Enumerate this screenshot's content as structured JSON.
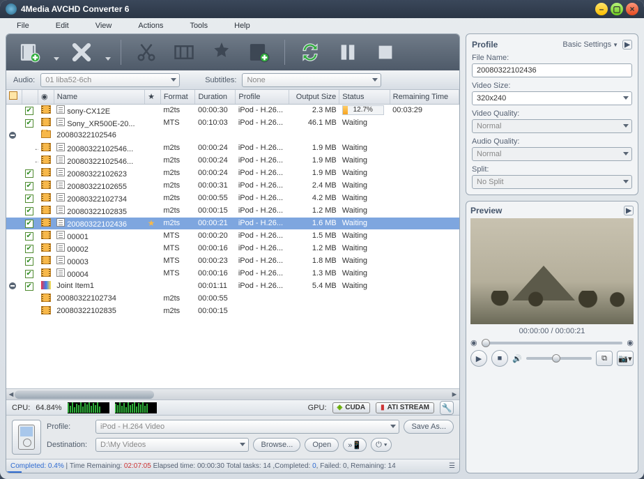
{
  "title": "4Media AVCHD Converter 6",
  "menu": {
    "file": "File",
    "edit": "Edit",
    "view": "View",
    "actions": "Actions",
    "tools": "Tools",
    "help": "Help"
  },
  "strip": {
    "audio_label": "Audio:",
    "audio_value": "01 liba52-6ch",
    "subtitles_label": "Subtitles:",
    "subtitles_value": "None"
  },
  "columns": {
    "name": "Name",
    "format": "Format",
    "duration": "Duration",
    "profile": "Profile",
    "output": "Output Size",
    "status": "Status",
    "remaining": "Remaining Time"
  },
  "rows": [
    {
      "type": "file",
      "indent": 0,
      "chk": true,
      "name": "sony-CX12E",
      "format": "m2ts",
      "duration": "00:00:30",
      "profile": "iPod - H.26...",
      "output": "2.3 MB",
      "status_pct": "12.7%",
      "remaining": "00:03:29"
    },
    {
      "type": "file",
      "indent": 0,
      "chk": true,
      "name": "Sony_XR500E-20...",
      "format": "MTS",
      "duration": "00:10:03",
      "profile": "iPod - H.26...",
      "output": "46.1 MB",
      "status": "Waiting",
      "remaining": ""
    },
    {
      "type": "folder",
      "indent": 0,
      "twisty": true,
      "name": "20080322102546"
    },
    {
      "type": "file",
      "indent": 1,
      "chk": true,
      "name": "20080322102546...",
      "format": "m2ts",
      "duration": "00:00:24",
      "profile": "iPod - H.26...",
      "output": "1.9 MB",
      "status": "Waiting",
      "remaining": ""
    },
    {
      "type": "file",
      "indent": 1,
      "chk": true,
      "name": "20080322102546...",
      "format": "m2ts",
      "duration": "00:00:24",
      "profile": "iPod - H.26...",
      "output": "1.9 MB",
      "status": "Waiting",
      "remaining": ""
    },
    {
      "type": "file",
      "indent": 0,
      "chk": true,
      "name": "20080322102623",
      "format": "m2ts",
      "duration": "00:00:24",
      "profile": "iPod - H.26...",
      "output": "1.9 MB",
      "status": "Waiting",
      "remaining": ""
    },
    {
      "type": "file",
      "indent": 0,
      "chk": true,
      "name": "20080322102655",
      "format": "m2ts",
      "duration": "00:00:31",
      "profile": "iPod - H.26...",
      "output": "2.4 MB",
      "status": "Waiting",
      "remaining": ""
    },
    {
      "type": "file",
      "indent": 0,
      "chk": true,
      "name": "20080322102734",
      "format": "m2ts",
      "duration": "00:00:55",
      "profile": "iPod - H.26...",
      "output": "4.2 MB",
      "status": "Waiting",
      "remaining": ""
    },
    {
      "type": "file",
      "indent": 0,
      "chk": true,
      "name": "20080322102835",
      "format": "m2ts",
      "duration": "00:00:15",
      "profile": "iPod - H.26...",
      "output": "1.2 MB",
      "status": "Waiting",
      "remaining": ""
    },
    {
      "type": "file",
      "indent": 0,
      "chk": true,
      "selected": true,
      "star": true,
      "name": "20080322102436",
      "format": "m2ts",
      "duration": "00:00:21",
      "profile": "iPod - H.26...",
      "output": "1.6 MB",
      "status": "Waiting",
      "remaining": ""
    },
    {
      "type": "file",
      "indent": 0,
      "chk": true,
      "name": "00001",
      "format": "MTS",
      "duration": "00:00:20",
      "profile": "iPod - H.26...",
      "output": "1.5 MB",
      "status": "Waiting",
      "remaining": ""
    },
    {
      "type": "file",
      "indent": 0,
      "chk": true,
      "name": "00002",
      "format": "MTS",
      "duration": "00:00:16",
      "profile": "iPod - H.26...",
      "output": "1.2 MB",
      "status": "Waiting",
      "remaining": ""
    },
    {
      "type": "file",
      "indent": 0,
      "chk": true,
      "name": "00003",
      "format": "MTS",
      "duration": "00:00:23",
      "profile": "iPod - H.26...",
      "output": "1.8 MB",
      "status": "Waiting",
      "remaining": ""
    },
    {
      "type": "file",
      "indent": 0,
      "chk": true,
      "name": "00004",
      "format": "MTS",
      "duration": "00:00:16",
      "profile": "iPod - H.26...",
      "output": "1.3 MB",
      "status": "Waiting",
      "remaining": ""
    },
    {
      "type": "joint",
      "indent": 0,
      "twisty": true,
      "chk": true,
      "name": "Joint Item1",
      "format": "",
      "duration": "00:01:11",
      "profile": "iPod - H.26...",
      "output": "5.4 MB",
      "status": "Waiting",
      "remaining": ""
    },
    {
      "type": "file",
      "indent": 1,
      "chk": false,
      "name": "20080322102734",
      "format": "m2ts",
      "duration": "00:00:55",
      "profile": "",
      "output": "",
      "status": "",
      "remaining": ""
    },
    {
      "type": "file",
      "indent": 1,
      "chk": false,
      "name": "20080322102835",
      "format": "m2ts",
      "duration": "00:00:15",
      "profile": "",
      "output": "",
      "status": "",
      "remaining": ""
    }
  ],
  "cpu": {
    "label": "CPU:",
    "value": "64.84%",
    "gpu_label": "GPU:",
    "cuda": "CUDA",
    "ati": "ATI STREAM"
  },
  "profdest": {
    "profile_label": "Profile:",
    "profile_value": "iPod - H.264 Video",
    "saveas": "Save As...",
    "dest_label": "Destination:",
    "dest_value": "D:\\My Videos",
    "browse": "Browse...",
    "open": "Open"
  },
  "status": {
    "completed_label": "Completed:",
    "completed_pct": "0.4%",
    "time_remaining_label": "Time Remaining:",
    "time_remaining": "02:07:05",
    "elapsed_label": "Elapsed time:",
    "elapsed": "00:00:30",
    "total_label": "Total tasks:",
    "total": "14",
    "completed_n_label": ",Completed:",
    "completed_n": "0",
    "failed_label": ", Failed:",
    "failed": "0",
    "remaining_label": ", Remaining:",
    "remaining": "14"
  },
  "profile_panel": {
    "title": "Profile",
    "basic": "Basic Settings",
    "filename_label": "File Name:",
    "filename": "20080322102436",
    "videosize_label": "Video Size:",
    "videosize": "320x240",
    "videoquality_label": "Video Quality:",
    "videoquality": "Normal",
    "audioquality_label": "Audio Quality:",
    "audioquality": "Normal",
    "split_label": "Split:",
    "split": "No Split"
  },
  "preview": {
    "title": "Preview",
    "time": "00:00:00 / 00:00:21"
  }
}
